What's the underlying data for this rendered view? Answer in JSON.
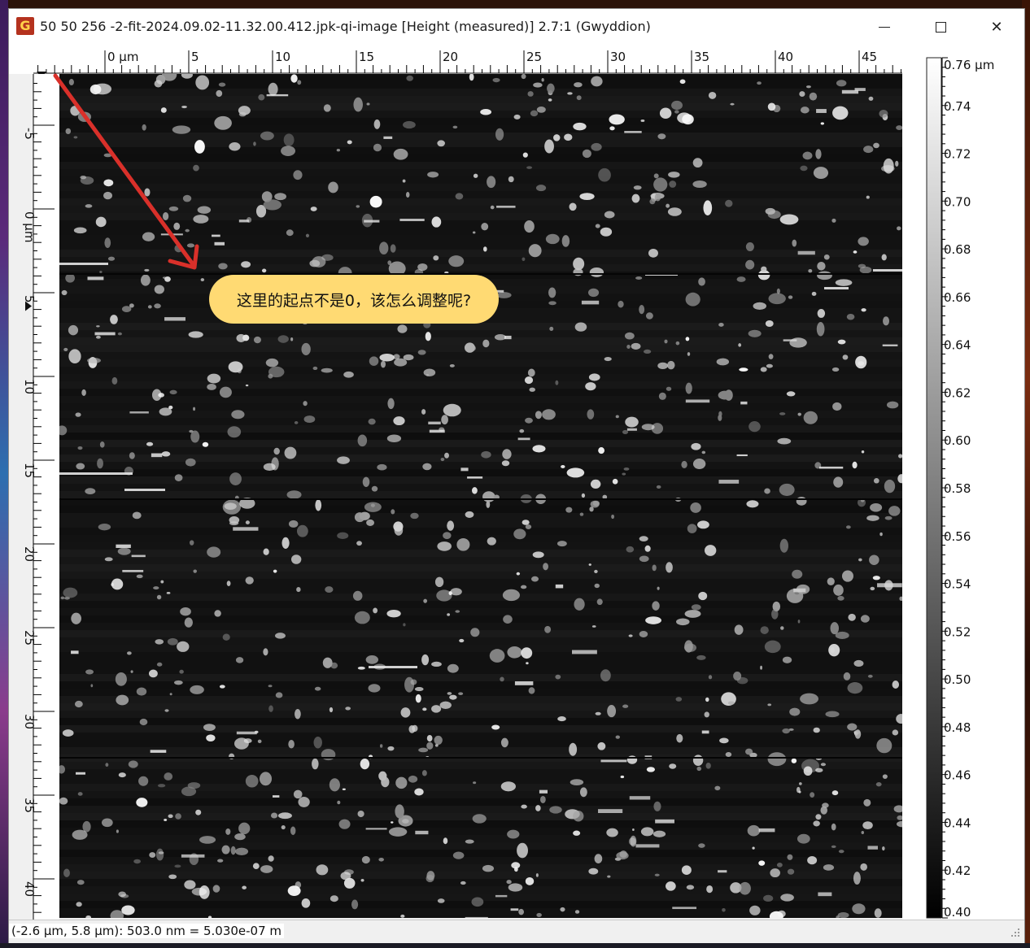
{
  "window": {
    "title": "50 50 256 -2-fit-2024.09.02-11.32.00.412.jpk-qi-image [Height (measured)] 2.7:1 (Gwyddion)",
    "app_icon_glyph": "G",
    "icons": {
      "app": "gwyddion-app-icon",
      "minimize": "minimize-icon",
      "maximize": "maximize-icon",
      "close": "close-icon"
    },
    "close_glyph": "✕"
  },
  "horizontal_ruler": {
    "labels": [
      "0 μm",
      "5",
      "10",
      "15",
      "20",
      "25",
      "30",
      "35",
      "40",
      "45"
    ],
    "values": [
      0,
      5,
      10,
      15,
      20,
      25,
      30,
      35,
      40,
      45
    ],
    "unit": "μm"
  },
  "vertical_ruler": {
    "labels": [
      "-5",
      "0 μm",
      "5",
      "10",
      "15",
      "20",
      "25",
      "30",
      "35",
      "40"
    ],
    "values": [
      -5,
      0,
      5,
      10,
      15,
      20,
      25,
      30,
      35,
      40
    ],
    "unit": "μm"
  },
  "color_scale": {
    "labels": [
      "0.76 μm",
      "0.74",
      "0.72",
      "0.70",
      "0.68",
      "0.66",
      "0.64",
      "0.62",
      "0.60",
      "0.58",
      "0.56",
      "0.54",
      "0.52",
      "0.50",
      "0.48",
      "0.46",
      "0.44",
      "0.42",
      "0.40"
    ],
    "min": 0.4,
    "max": 0.76,
    "unit": "μm"
  },
  "annotation": {
    "text": "这里的起点不是0，该怎么调整呢?",
    "bubble_color": "#ffda73",
    "arrow_color": "#d9302a"
  },
  "status_bar": {
    "text": "(-2.6 μm, 5.8 μm): 503.0 nm = 5.030e-07 m"
  }
}
